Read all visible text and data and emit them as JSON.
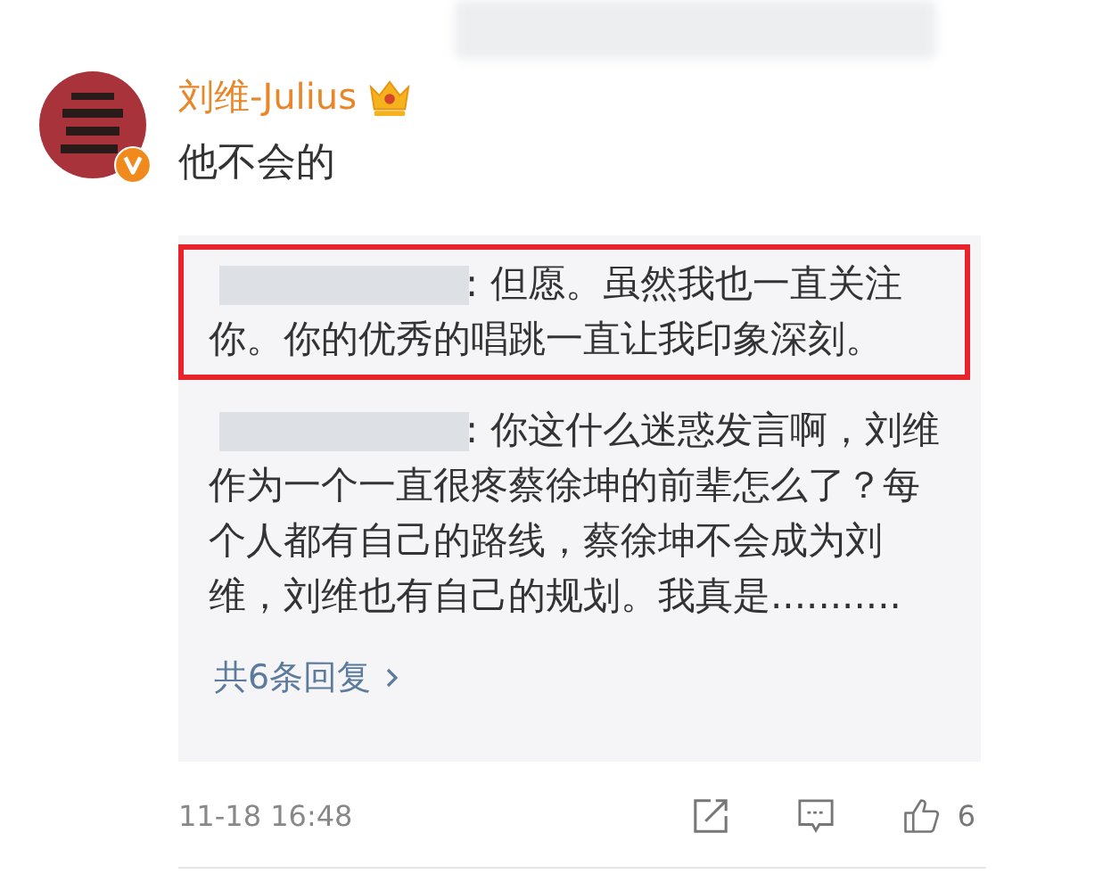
{
  "comment": {
    "author": "刘维-Julius",
    "text": "他不会的",
    "verified": true,
    "vip": true
  },
  "replies": [
    {
      "text": ": 但愿。虽然我也一直关注你。你的优秀的唱跳一直让我印象深刻。",
      "highlighted": true
    },
    {
      "text": ": 你这什么迷惑发言啊，刘维作为一个一直很疼蔡徐坤的前辈怎么了？每个人都有自己的路线，蔡徐坤不会成为刘维，刘维也有自己的规划。我真是...........",
      "highlighted": false
    }
  ],
  "more_replies": "共6条回复",
  "time": "11-18 16:48",
  "likes": "6"
}
